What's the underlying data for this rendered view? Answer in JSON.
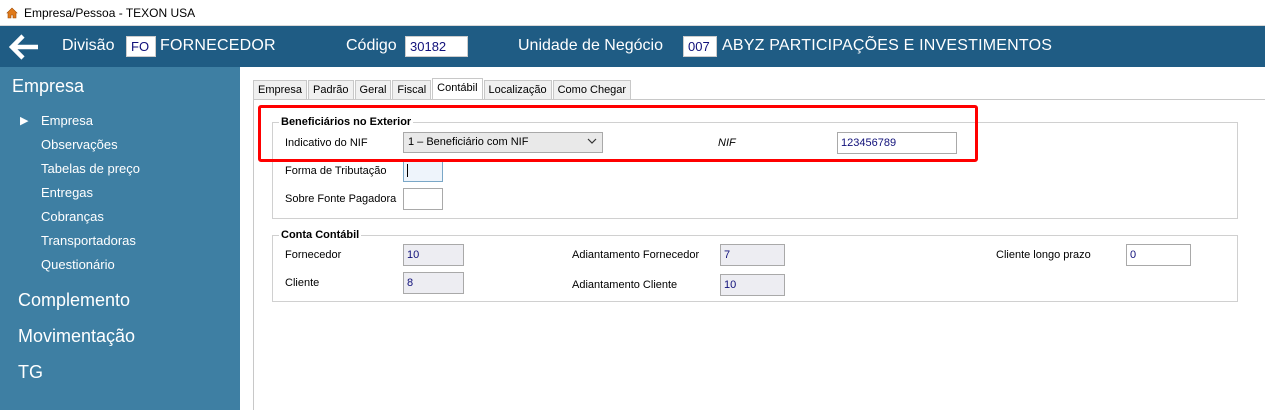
{
  "window": {
    "title": "Empresa/Pessoa - TEXON USA"
  },
  "header": {
    "divisao_label": "Divisão",
    "divisao_code": "FO",
    "divisao_name": "FORNECEDOR",
    "codigo_label": "Código",
    "codigo_value": "30182",
    "unidade_label": "Unidade de Negócio",
    "unidade_code": "007",
    "unidade_name": "ABYZ PARTICIPAÇÕES E INVESTIMENTOS"
  },
  "sidebar": {
    "title": "Empresa",
    "items": [
      {
        "label": "Empresa"
      },
      {
        "label": "Observações"
      },
      {
        "label": "Tabelas de preço"
      },
      {
        "label": "Entregas"
      },
      {
        "label": "Cobranças"
      },
      {
        "label": "Transportadoras"
      },
      {
        "label": "Questionário"
      }
    ],
    "groups": [
      {
        "label": "Complemento"
      },
      {
        "label": "Movimentação"
      },
      {
        "label": "TG"
      }
    ]
  },
  "tabs": [
    {
      "label": "Empresa"
    },
    {
      "label": "Padrão"
    },
    {
      "label": "Geral"
    },
    {
      "label": "Fiscal"
    },
    {
      "label": "Contábil",
      "active": true
    },
    {
      "label": "Localização"
    },
    {
      "label": "Como Chegar"
    }
  ],
  "beneficiarios": {
    "title": "Beneficiários no Exterior",
    "indicativo_label": "Indicativo do NIF",
    "indicativo_value": "1 – Beneficiário com NIF",
    "nif_label": "NIF",
    "nif_value": "123456789",
    "forma_label": "Forma de Tributação",
    "forma_value": "",
    "sobre_label": "Sobre Fonte Pagadora",
    "sobre_value": ""
  },
  "conta_contabil": {
    "title": "Conta Contábil",
    "fornecedor_label": "Fornecedor",
    "fornecedor_value": "10",
    "cliente_label": "Cliente",
    "cliente_value": "8",
    "adiant_fornecedor_label": "Adiantamento Fornecedor",
    "adiant_fornecedor_value": "7",
    "adiant_cliente_label": "Adiantamento Cliente",
    "adiant_cliente_value": "10",
    "cliente_longo_label": "Cliente longo prazo",
    "cliente_longo_value": "0"
  },
  "colors": {
    "header_bg": "#1f5c84",
    "sidebar_bg": "#3e7fa3",
    "highlight": "#ff0000",
    "field_text": "#10107a"
  },
  "icons": {
    "app": "house-icon",
    "back": "arrow-left-icon",
    "active_item": "triangle-right-icon",
    "dropdown": "chevron-down-icon"
  }
}
